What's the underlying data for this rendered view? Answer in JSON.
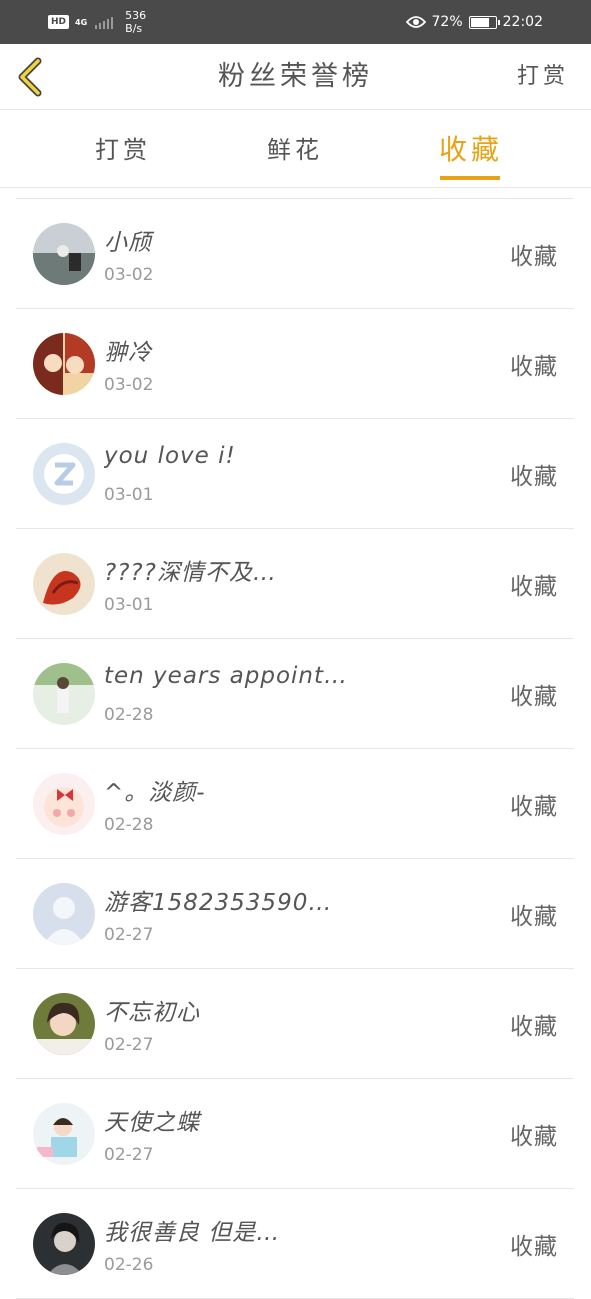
{
  "status_bar": {
    "hd": "HD",
    "network": "4G",
    "speed_value": "536",
    "speed_unit": "B/s",
    "battery": "72%",
    "time": "22:02",
    "battery_level": 0.72
  },
  "header": {
    "title": "粉丝荣誉榜",
    "action": "打赏",
    "back_icon": "chevron-left-icon"
  },
  "tabs": [
    {
      "label": "打赏",
      "active": false
    },
    {
      "label": "鲜花",
      "active": false
    },
    {
      "label": "收藏",
      "active": true
    }
  ],
  "colors": {
    "accent": "#e8a317",
    "status_bar": "#4a4a4a",
    "text": "#555555",
    "subtext": "#9a9a9a",
    "divider": "#e6e6e6"
  },
  "fans": [
    {
      "name": "小颀",
      "date": "03-02",
      "action": "收藏"
    },
    {
      "name": "翀冷",
      "date": "03-02",
      "action": "收藏"
    },
    {
      "name": "you love i!",
      "date": "03-01",
      "action": "收藏"
    },
    {
      "name": "????深情不及…",
      "date": "03-01",
      "action": "收藏"
    },
    {
      "name": "ten years appoint…",
      "date": "02-28",
      "action": "收藏"
    },
    {
      "name": "^。淡颜-",
      "date": "02-28",
      "action": "收藏"
    },
    {
      "name": "游客1582353590…",
      "date": "02-27",
      "action": "收藏"
    },
    {
      "name": "不忘初心",
      "date": "02-27",
      "action": "收藏"
    },
    {
      "name": "天使之蝶",
      "date": "02-27",
      "action": "收藏"
    },
    {
      "name": "我很善良 但是…",
      "date": "02-26",
      "action": "收藏"
    }
  ]
}
